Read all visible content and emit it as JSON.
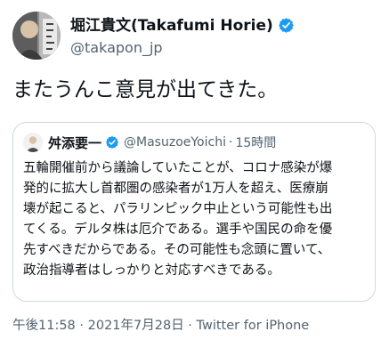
{
  "author": {
    "display_name": "堀江貴文(Takafumi Horie)",
    "handle": "@takapon_jp",
    "verified_icon": "verified-badge-icon",
    "accent": "#1d9bf0"
  },
  "tweet": {
    "text": "またうんこ意見が出てきた。"
  },
  "quote": {
    "display_name": "舛添要一",
    "handle": "@MasuzoeYoichi",
    "separator": "·",
    "time": "15時間",
    "text_lines": [
      "五輪開催前から議論していたことが、コロナ感染が爆",
      "発的に拡大し首都圏の感染者が1万人を超え、医療崩",
      "壊が起こると、パラリンピック中止という可能性も出",
      "てくる。デルタ株は厄介である。選手や国民の命を優",
      "先すべきだからである。その可能性も念頭に置いて、",
      "政治指導者はしっかりと対応すべきである。"
    ]
  },
  "meta": {
    "time": "午後11:58",
    "sep1": " · ",
    "date": "2021年7月28日",
    "sep2": " · ",
    "source": "Twitter for iPhone"
  }
}
